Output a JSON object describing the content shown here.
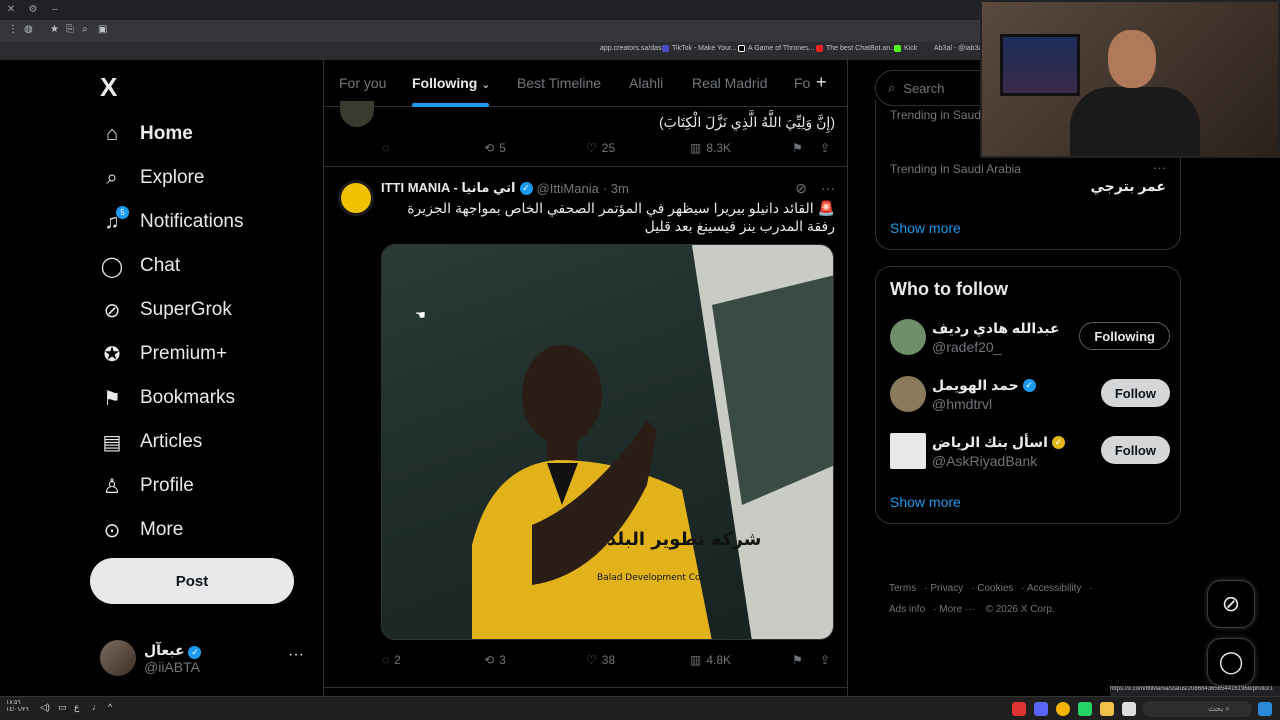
{
  "browser": {
    "bookmarks": [
      {
        "label": "app.creators.sa/das...",
        "color": "#888888"
      },
      {
        "label": "TikTok - Make Your...",
        "color": "#ff0050"
      },
      {
        "label": "A Game of Thrones...",
        "color": "#ffffff"
      },
      {
        "label": "The best ChatBot an...",
        "color": "#ff0000"
      },
      {
        "label": "Kick",
        "color": "#53fc18"
      },
      {
        "label": "Ab3al - @iab3al",
        "color": "#888888"
      }
    ],
    "status_url": "https://x.com/IttiMania/status/2086843656544161968/photo/1"
  },
  "nav": {
    "logo": "X",
    "items": [
      {
        "label": "Home",
        "icon": "home-icon",
        "glyph": "⌂",
        "active": true
      },
      {
        "label": "Explore",
        "icon": "search-icon",
        "glyph": "⌕"
      },
      {
        "label": "Notifications",
        "icon": "bell-icon",
        "glyph": "🔔",
        "badge": "5"
      },
      {
        "label": "Chat",
        "icon": "chat-icon",
        "glyph": "◯"
      },
      {
        "label": "SuperGrok",
        "icon": "grok-icon",
        "glyph": "⊘"
      },
      {
        "label": "Premium+",
        "icon": "premium-icon",
        "glyph": "✪"
      },
      {
        "label": "Bookmarks",
        "icon": "bookmark-icon",
        "glyph": "⚑"
      },
      {
        "label": "Articles",
        "icon": "articles-icon",
        "glyph": "▤"
      },
      {
        "label": "Profile",
        "icon": "profile-icon",
        "glyph": "♙"
      },
      {
        "label": "More",
        "icon": "more-circle-icon",
        "glyph": "⊙"
      }
    ],
    "post_label": "Post",
    "account": {
      "name": "عبعآل",
      "handle": "@iiABTA"
    }
  },
  "timeline": {
    "tabs": [
      "For you",
      "Following",
      "Best Timeline",
      "Alahli",
      "Real Madrid",
      "Fo"
    ],
    "active_tab": "Following",
    "tweet1": {
      "text": "(إِنَّ وَلِيِّيَ اللَّهُ الَّذِي نَزَّلَ الْكِتَابَ)",
      "replies": "",
      "reposts": "5",
      "likes": "25",
      "views": "8.3K"
    },
    "tweet2": {
      "name": "ITTI MANIA - اتي مانيا",
      "handle": "@IttiMania",
      "time": "· 3m",
      "text": "🚨 القائد دانيلو بيريرا سيظهر في المؤتمر الصحفي الخاص بمواجهة الجزيرة رفقة المدرب ينز فيسينغ بعد قليل",
      "replies": "2",
      "reposts": "3",
      "likes": "38",
      "views": "4.8K",
      "shirt_text": "شركة تطوير البلد",
      "shirt_sub": "Balad Development Co."
    }
  },
  "right": {
    "search_placeholder": "Search",
    "trends": [
      {
        "meta": "Trending in Saudi Arabia",
        "name": ""
      },
      {
        "meta": "Trending in Saudi Arabia",
        "name": "عمر بترجي"
      }
    ],
    "show_more": "Show more",
    "who_to_follow": {
      "title": "Who to follow",
      "users": [
        {
          "name": "عبدالله هادي رديف",
          "handle": "@radef20_",
          "button": "Following",
          "state": "following",
          "avatar_color": "#7aa07a"
        },
        {
          "name": "حمد الهويمل",
          "handle": "@hmdtrvl",
          "button": "Follow",
          "state": "follow",
          "avatar_color": "#8a7a5c",
          "verified": true
        },
        {
          "name": "اسأل بنك الرياض",
          "handle": "@AskRiyadBank",
          "button": "Follow",
          "state": "follow",
          "avatar_color": "#2a5ea8",
          "gold": true
        }
      ],
      "show_more": "Show more"
    },
    "footer": [
      "Terms",
      "Privacy",
      "Cookies",
      "Accessibility",
      "Ads info",
      "More ···",
      "© 2026 X Corp."
    ]
  },
  "taskbar": {
    "time": "١٨:٥٦",
    "date": "١٤/٠١/٢٦",
    "search_label": "بحث"
  }
}
